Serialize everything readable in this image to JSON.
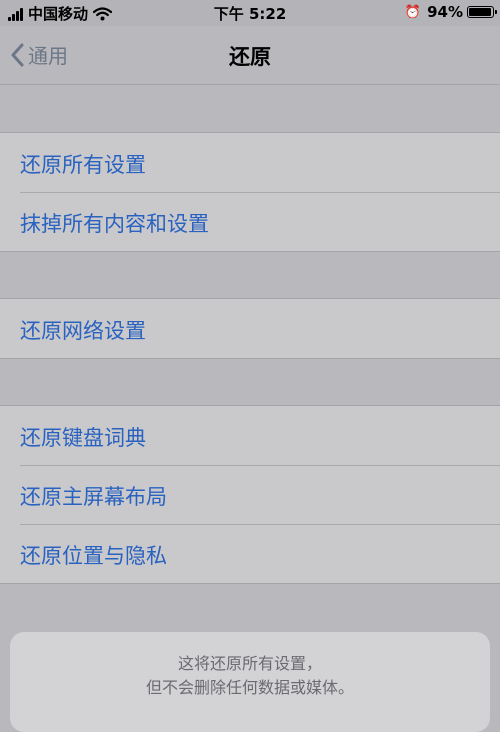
{
  "status": {
    "carrier": "中国移动",
    "time": "下午 5:22",
    "battery_percent": "94%",
    "battery_level": 0.94
  },
  "nav": {
    "back_label": "通用",
    "title": "还原"
  },
  "groups": [
    {
      "items": [
        {
          "label": "还原所有设置"
        },
        {
          "label": "抹掉所有内容和设置"
        }
      ]
    },
    {
      "items": [
        {
          "label": "还原网络设置"
        }
      ]
    },
    {
      "items": [
        {
          "label": "还原键盘词典"
        },
        {
          "label": "还原主屏幕布局"
        },
        {
          "label": "还原位置与隐私"
        }
      ]
    }
  ],
  "alert": {
    "line1": "这将还原所有设置，",
    "line2": "但不会删除任何数据或媒体。"
  },
  "colors": {
    "link": "#2a62c0",
    "background": "#b9b9bd",
    "cell": "#c9c9cc"
  },
  "icons": [
    "signal-icon",
    "wifi-icon",
    "alarm-icon",
    "battery-icon",
    "chevron-left-icon"
  ]
}
